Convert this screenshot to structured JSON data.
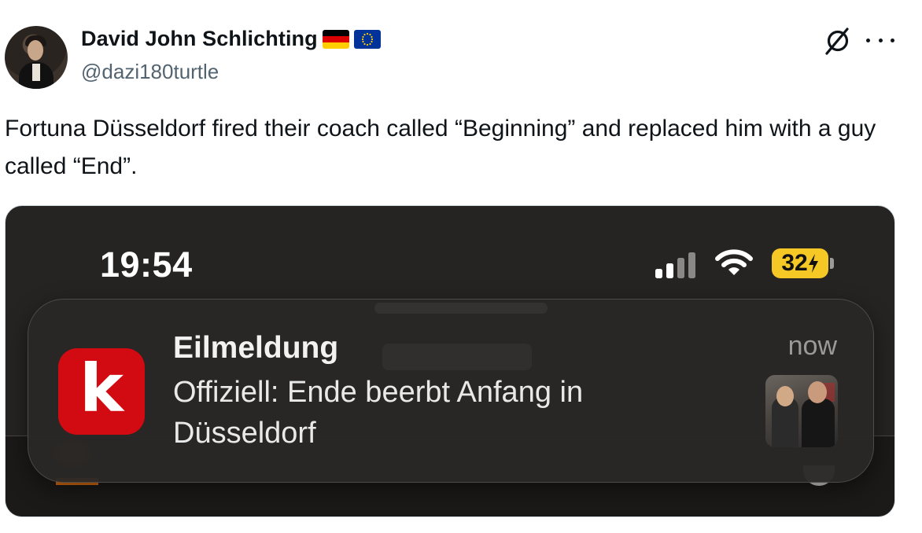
{
  "author": {
    "display_name": "David John Schlichting",
    "handle": "@dazi180turtle",
    "badges": [
      "flag-germany-icon",
      "flag-eu-icon"
    ]
  },
  "header_actions": {
    "grok_icon": "grok-icon",
    "more_icon": "more-icon"
  },
  "tweet": {
    "text": "Fortuna Düsseldorf fired their coach called “Beginning” and replaced him with a guy called “End”."
  },
  "screenshot": {
    "status_bar": {
      "time": "19:54",
      "battery": "32"
    },
    "notification": {
      "app_icon_letter": "k",
      "title": "Eilmeldung",
      "time": "now",
      "body": "Offiziell: Ende beerbt Anfang in Düsseldorf"
    }
  },
  "colors": {
    "handle_gray": "#536471",
    "battery_yellow": "#f5c826",
    "app_red": "#d20a11",
    "dark_bg": "#262422"
  }
}
